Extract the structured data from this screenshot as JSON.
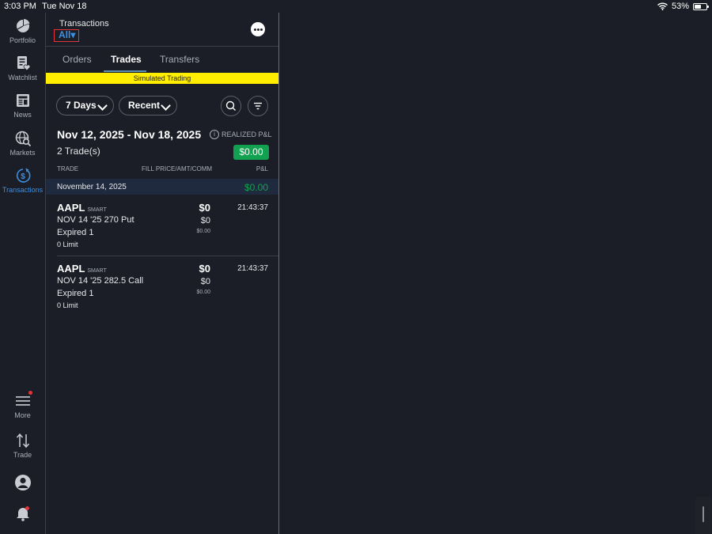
{
  "status_bar": {
    "time": "3:03 PM",
    "date": "Tue Nov 18",
    "battery": "53%",
    "battery_level": 0.53
  },
  "sidebar": {
    "items": [
      {
        "label": "Portfolio",
        "icon": "pie-chart-icon"
      },
      {
        "label": "Watchlist",
        "icon": "watchlist-icon"
      },
      {
        "label": "News",
        "icon": "newspaper-icon"
      },
      {
        "label": "Markets",
        "icon": "globe-search-icon"
      },
      {
        "label": "Transactions",
        "icon": "dollar-cycle-icon",
        "active": true
      },
      {
        "label": "More",
        "icon": "menu-icon"
      },
      {
        "label": "Trade",
        "icon": "up-down-arrows-icon"
      },
      {
        "label": "",
        "icon": "user-avatar-icon"
      },
      {
        "label": "",
        "icon": "bell-icon"
      }
    ],
    "accent_color": "#3d8fe0"
  },
  "header": {
    "title": "Transactions",
    "filter": "All▾"
  },
  "tabs": [
    {
      "label": "Orders",
      "active": false
    },
    {
      "label": "Trades",
      "active": true
    },
    {
      "label": "Transfers",
      "active": false
    }
  ],
  "banner": {
    "text": "Simulated Trading",
    "color": "#ffee00"
  },
  "filters": {
    "period": "7 Days",
    "sort": "Recent"
  },
  "summary": {
    "date_range": "Nov 12, 2025 - Nov 18, 2025",
    "trade_count": "2 Trade(s)",
    "realized_label": "REALIZED P&L",
    "realized_value": "$0.00",
    "positive_color": "#12a150"
  },
  "columns": {
    "trade": "TRADE",
    "fill": "FILL PRICE/AMT/COMM",
    "pnl": "P&L"
  },
  "groups": [
    {
      "date": "November 14, 2025",
      "total": "$0.00",
      "trades": [
        {
          "symbol": "AAPL",
          "exchange": "SMART",
          "description": "NOV 14 '25 270 Put",
          "status": "Expired 1",
          "order": "0 Limit",
          "price": "$0",
          "amount": "$0",
          "commission": "$0.00",
          "time": "21:43:37"
        },
        {
          "symbol": "AAPL",
          "exchange": "SMART",
          "description": "NOV 14 '25 282.5 Call",
          "status": "Expired 1",
          "order": "0 Limit",
          "price": "$0",
          "amount": "$0",
          "commission": "$0.00",
          "time": "21:43:37"
        }
      ]
    }
  ]
}
